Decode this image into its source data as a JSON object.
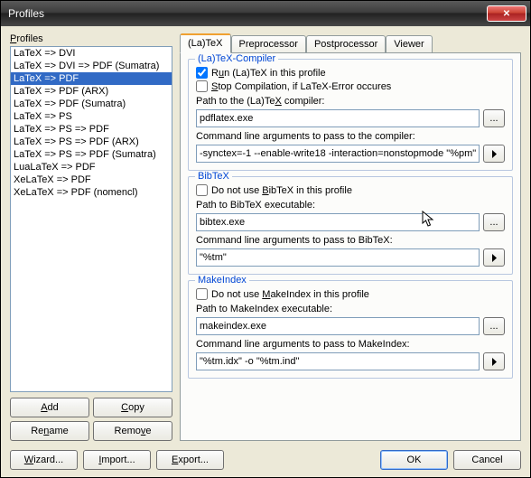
{
  "window": {
    "title": "Profiles"
  },
  "left": {
    "header": "Profiles",
    "items": [
      "LaTeX => DVI",
      "LaTeX => DVI => PDF (Sumatra)",
      "LaTeX => PDF",
      "LaTeX => PDF (ARX)",
      "LaTeX => PDF (Sumatra)",
      "LaTeX => PS",
      "LaTeX => PS => PDF",
      "LaTeX => PS => PDF (ARX)",
      "LaTeX => PS => PDF (Sumatra)",
      "LuaLaTeX => PDF",
      "XeLaTeX => PDF",
      "XeLaTeX => PDF (nomencl)"
    ],
    "selected_index": 2,
    "buttons": {
      "add": "Add",
      "copy": "Copy",
      "rename": "Rename",
      "remove": "Remove"
    }
  },
  "tabs": {
    "latex": "(La)TeX",
    "pre": "Preprocessor",
    "post": "Postprocessor",
    "viewer": "Viewer"
  },
  "latex": {
    "legend": "(La)TeX-Compiler",
    "run_pre": "R",
    "run_u": "u",
    "run_post": "n (La)TeX in this profile",
    "run_checked": true,
    "stop_pre": "",
    "stop_u": "S",
    "stop_post": "top Compilation, if LaTeX-Error occures",
    "stop_checked": false,
    "path_pre": "Path to the (La)Te",
    "path_u": "X",
    "path_post": " compiler:",
    "path_val": "pdflatex.exe",
    "args_pre": "Command line ar",
    "args_u": "g",
    "args_post": "uments to pass to the compiler:",
    "args_val": "-synctex=-1 --enable-write18 -interaction=nonstopmode \"%pm\""
  },
  "bibtex": {
    "legend": "BibTeX",
    "dont_pre": "Do not use ",
    "dont_u": "B",
    "dont_post": "ibTeX in this profile",
    "dont_checked": false,
    "path_label": "Path to BibTeX executable:",
    "path_val": "bibtex.exe",
    "args_label": "Command line arguments to pass to BibTeX:",
    "args_val": "\"%tm\""
  },
  "makeindex": {
    "legend": "MakeIndex",
    "dont_pre": "Do not use ",
    "dont_u": "M",
    "dont_post": "akeIndex in this profile",
    "dont_checked": false,
    "path_label": "Path to MakeIndex executable:",
    "path_val": "makeindex.exe",
    "args_label": "Command line arguments to pass to MakeIndex:",
    "args_val": "\"%tm.idx\" -o \"%tm.ind\""
  },
  "bottom": {
    "wizard_pre": "",
    "wizard_u": "W",
    "wizard_post": "izard...",
    "import_pre": "",
    "import_u": "I",
    "import_post": "mport...",
    "export_pre": "",
    "export_u": "E",
    "export_post": "xport...",
    "ok": "OK",
    "cancel": "Cancel"
  },
  "icons": {
    "browse": "...",
    "arrow": "▶"
  }
}
